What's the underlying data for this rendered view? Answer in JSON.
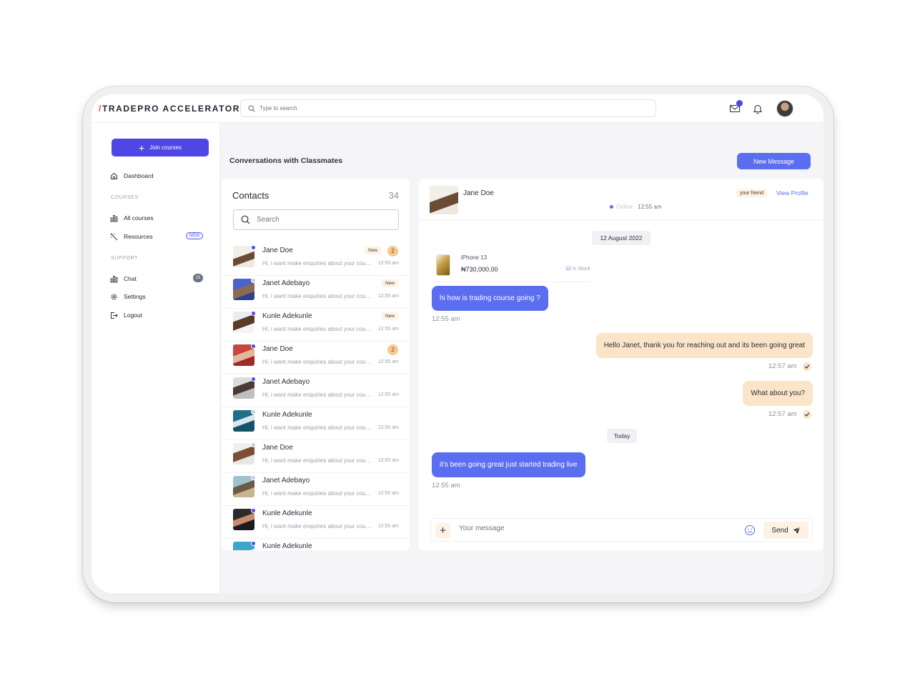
{
  "app": {
    "logo_slash": "/",
    "logo_text": "TRADEPRO ACCELERATOR"
  },
  "search": {
    "placeholder": "Type to search"
  },
  "sidebar": {
    "join_label": "Join courses",
    "dashboard": "Dashboard",
    "courses_title": "COURSES",
    "all_courses": "All courses",
    "resources": "Resources",
    "resources_badge": "NEW",
    "support_title": "SUPPORT",
    "chat": "Chat",
    "chat_count": "15",
    "settings": "Settings",
    "logout": "Logout"
  },
  "main": {
    "title": "Conversations with Classmates",
    "new_message": "New Message"
  },
  "contacts": {
    "title": "Contacts",
    "count": "34",
    "search_placeholder": "Search",
    "items": [
      {
        "name": "Jane Doe",
        "preview": "Hi, i want make enquiries about your course",
        "time": "12:55 am",
        "new": "New",
        "unread": "2",
        "online": true
      },
      {
        "name": "Janet Adebayo",
        "preview": "Hi, i want make enquiries about your course",
        "time": "12:55 am",
        "new": "New",
        "unread": "",
        "online": false
      },
      {
        "name": "Kunle Adekunle",
        "preview": "Hi, i want make enquiries about your course",
        "time": "12:55 am",
        "new": "New",
        "unread": "",
        "online": true
      },
      {
        "name": "Jane Doe",
        "preview": "Hi, i want make enquiries about your course",
        "time": "12:55 am",
        "new": "",
        "unread": "2",
        "online": true
      },
      {
        "name": "Janet Adebayo",
        "preview": "Hi, i want make enquiries about your course",
        "time": "12:55 am",
        "new": "",
        "unread": "",
        "online": true
      },
      {
        "name": "Kunle Adekunle",
        "preview": "Hi, i want make enquiries about your course",
        "time": "12:55 am",
        "new": "",
        "unread": "",
        "online": false
      },
      {
        "name": "Jane Doe",
        "preview": "Hi, i want make enquiries about your course",
        "time": "12:55 am",
        "new": "",
        "unread": "",
        "online": false
      },
      {
        "name": "Janet Adebayo",
        "preview": "Hi, i want make enquiries about your course",
        "time": "12:55 am",
        "new": "",
        "unread": "",
        "online": false
      },
      {
        "name": "Kunle Adekunle",
        "preview": "Hi, i want make enquiries about your course",
        "time": "12:55 am",
        "new": "",
        "unread": "",
        "online": true
      },
      {
        "name": "Kunle Adekunle",
        "preview": "",
        "time": "",
        "new": "",
        "unread": "",
        "online": true
      }
    ]
  },
  "chat": {
    "name": "Jane Doe",
    "status": "Online",
    "status_time": "12:55 am",
    "friend_badge": "your friend",
    "view_profile": "View Profile",
    "date_1": "12 August 2022",
    "product": {
      "name": "iPhone 13",
      "price": "₦730,000.00",
      "stock_count": "12",
      "stock_label": "In Stock"
    },
    "messages": [
      {
        "text": "hi  how is trading course going ?",
        "time": "12:55 am"
      },
      {
        "text": "Hello Janet, thank you for reaching out and its been going great",
        "time": "12:57 am"
      },
      {
        "text": "What about you?",
        "time": "12:57 am"
      },
      {
        "text": "it's been going great just started trading live",
        "time": "12:55 am"
      }
    ],
    "date_2": "Today",
    "composer_placeholder": "Your message",
    "send_label": "Send"
  },
  "colors": {
    "accent": "#4f46e5",
    "bubble_in": "#5b6ef0",
    "bubble_out": "#fbe4c8",
    "badge_bg": "#fdf2e4"
  },
  "icons": [
    "search-icon",
    "mail-icon",
    "bell-icon",
    "home-icon",
    "bar-chart-icon",
    "magic-wand-icon",
    "gear-icon",
    "logout-icon",
    "plus-icon",
    "smile-icon",
    "send-icon",
    "check-icon"
  ]
}
